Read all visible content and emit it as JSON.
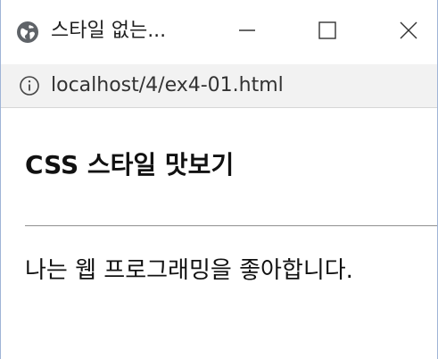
{
  "window": {
    "tab_title": "스타일 없는...",
    "tab_icon": "globe-icon",
    "controls": {
      "minimize_icon": "minimize-icon",
      "maximize_icon": "maximize-icon",
      "close_icon": "close-icon"
    }
  },
  "address_bar": {
    "info_icon": "info-icon",
    "url": "localhost/4/ex4-01.html"
  },
  "page": {
    "heading": "CSS 스타일 맛보기",
    "paragraph": "나는 웹 프로그래밍을 좋아합니다."
  },
  "colors": {
    "address_bar_bg": "#f2f2f2",
    "window_border": "#9fb4d6",
    "text": "#111111"
  }
}
